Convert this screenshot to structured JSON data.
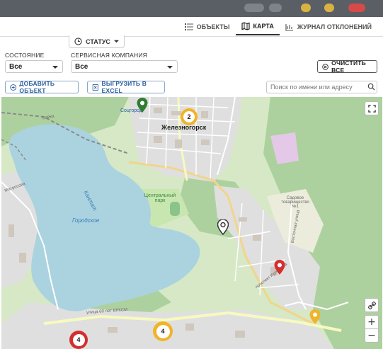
{
  "tabs": [
    {
      "label": "ОБЪЕКТЫ",
      "icon": "list-icon"
    },
    {
      "label": "КАРТА",
      "icon": "map-icon",
      "active": true
    },
    {
      "label": "ЖУРНАЛ ОТКЛОНЕНИЙ",
      "icon": "journal-icon"
    }
  ],
  "status_button": {
    "label": "СТАТУС"
  },
  "filters": {
    "state": {
      "label": "СОСТОЯНИЕ",
      "value": "Все"
    },
    "company": {
      "label": "СЕРВИСНАЯ КОМПАНИЯ",
      "value": "Все"
    }
  },
  "actions": {
    "clear_all": "ОЧИСТИТЬ ВСЕ",
    "add_object": "ДОБАВИТЬ ОБЪЕКТ",
    "export_excel": "ВЫГРУЗИТЬ В EXCEL"
  },
  "search": {
    "placeholder": "Поиск по имени или адресу"
  },
  "map": {
    "labels": {
      "city": "Железногорск",
      "lake": "Городское",
      "canal": "Кантат",
      "park": "Центральный парк",
      "sadovoe": "Садовое товарищество №1",
      "sotsgorod": "Соцгород",
      "baika": "Байка",
      "matrosova": "Матросова",
      "prospekt": "проспект Курчатова",
      "ulitsa_60": "улица 60 лет ВЛКСМ",
      "vostochnaya": "Восточная улица"
    },
    "clusters": [
      {
        "count": "2",
        "color": "#f0b429"
      },
      {
        "count": "4",
        "color": "#f0b429"
      },
      {
        "count": "4",
        "color": "#d32f2f"
      }
    ],
    "zoom_in": "+",
    "zoom_out": "−"
  },
  "colors": {
    "accent": "#2b5f9e",
    "water": "#aad3df",
    "green": "#add19e",
    "urban": "#e0dfdf",
    "road": "#f7fabf"
  }
}
